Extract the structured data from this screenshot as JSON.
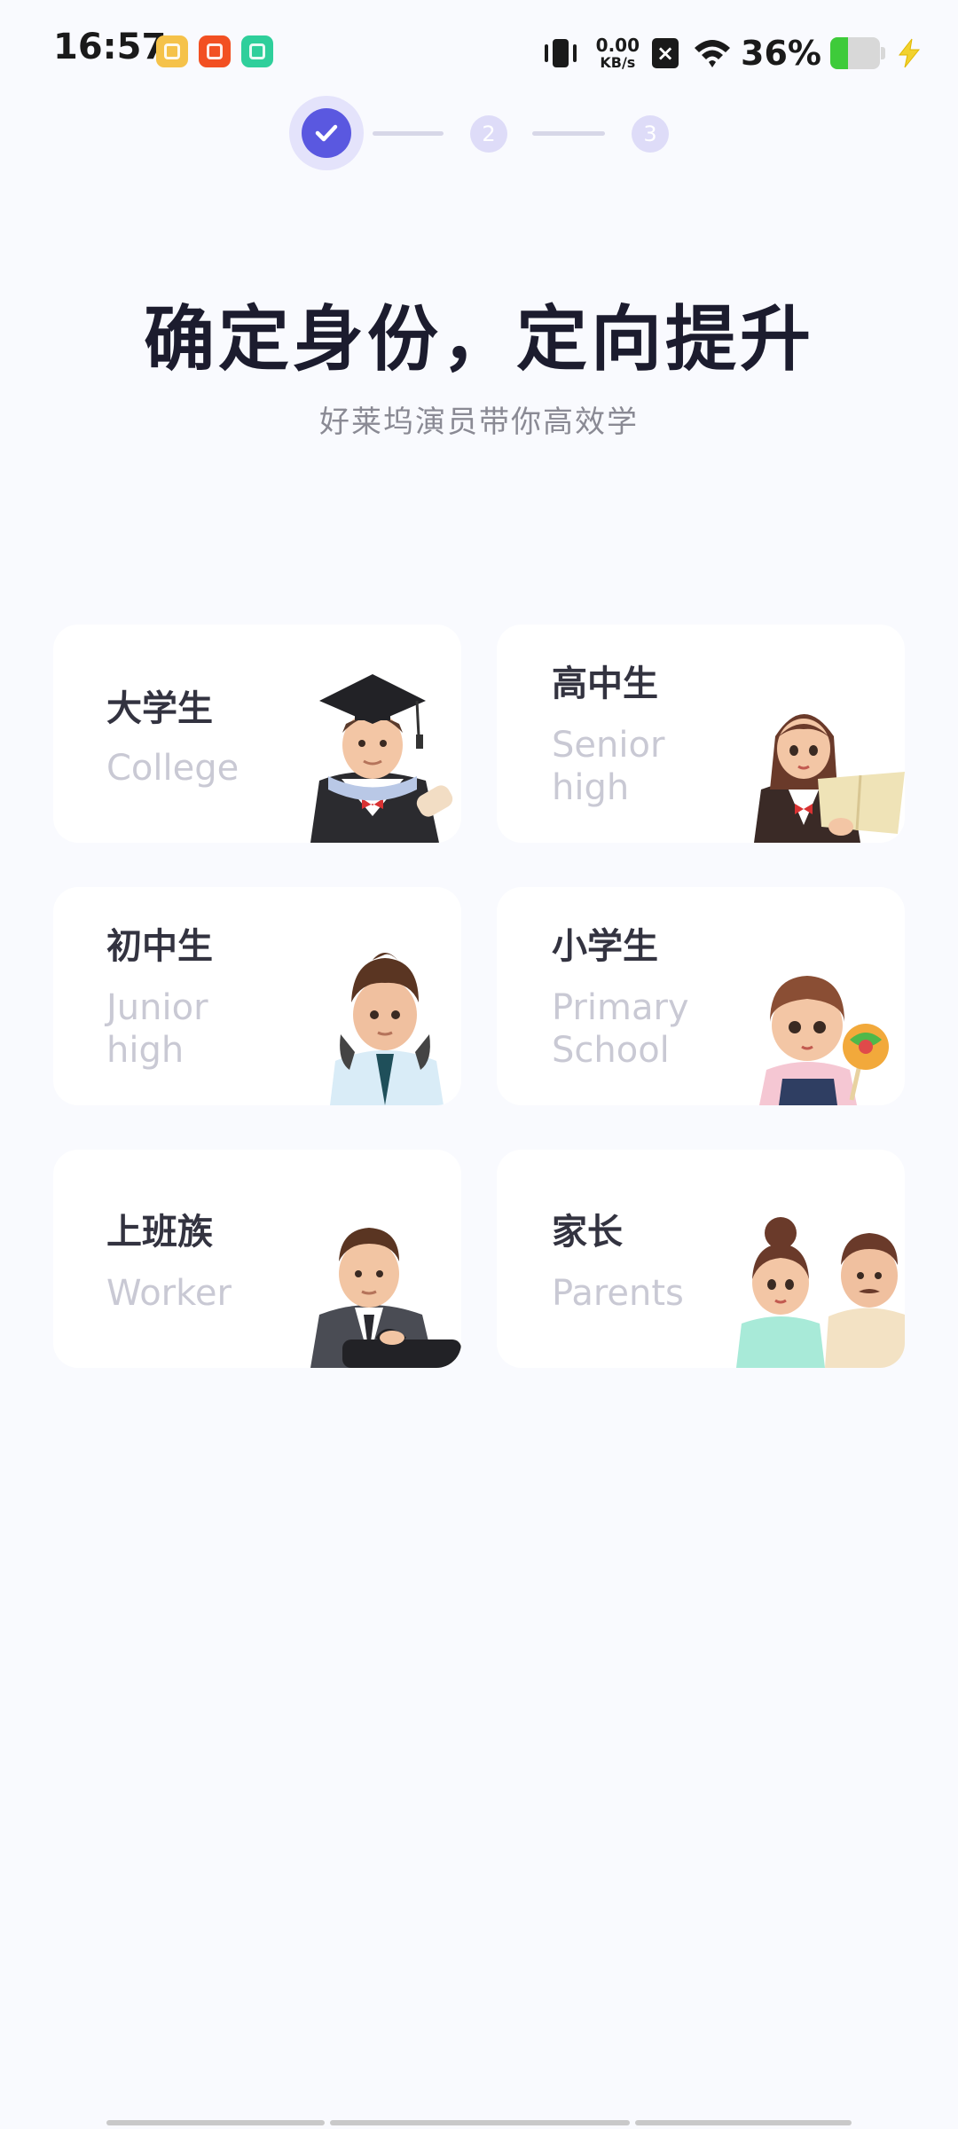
{
  "status_bar": {
    "time": "16:57",
    "net_speed_value": "0.00",
    "net_speed_unit": "KB/s",
    "battery_percent": "36%",
    "battery_level": 0.36,
    "icons": [
      "files-app-icon",
      "kuaishou-app-icon",
      "home-app-icon",
      "vibrate-icon",
      "no-sim-icon",
      "wifi-icon",
      "battery-icon",
      "charging-icon"
    ]
  },
  "stepper": {
    "current_step": 1,
    "steps": [
      {
        "label": "1",
        "state": "done"
      },
      {
        "label": "2",
        "state": "pending"
      },
      {
        "label": "3",
        "state": "pending"
      }
    ]
  },
  "header": {
    "title": "确定身份，定向提升",
    "subtitle": "好莱坞演员带你高效学"
  },
  "identities": [
    {
      "cn": "大学生",
      "en": "College",
      "avatar": "college-graduate-avatar"
    },
    {
      "cn": "高中生",
      "en": "Senior high",
      "avatar": "senior-high-girl-avatar"
    },
    {
      "cn": "初中生",
      "en": "Junior high",
      "avatar": "junior-high-boy-avatar"
    },
    {
      "cn": "小学生",
      "en": "Primary School",
      "avatar": "primary-school-child-avatar"
    },
    {
      "cn": "上班族",
      "en": "Worker",
      "avatar": "office-worker-avatar"
    },
    {
      "cn": "家长",
      "en": "Parents",
      "avatar": "parents-avatar"
    }
  ],
  "colors": {
    "accent": "#5a58e0",
    "accent_light": "#e4e3fb",
    "background": "#f9fafe",
    "card": "#ffffff",
    "title": "#1c1c2e",
    "subtitle": "#8a8a94",
    "label_en": "#c9c9d4"
  }
}
